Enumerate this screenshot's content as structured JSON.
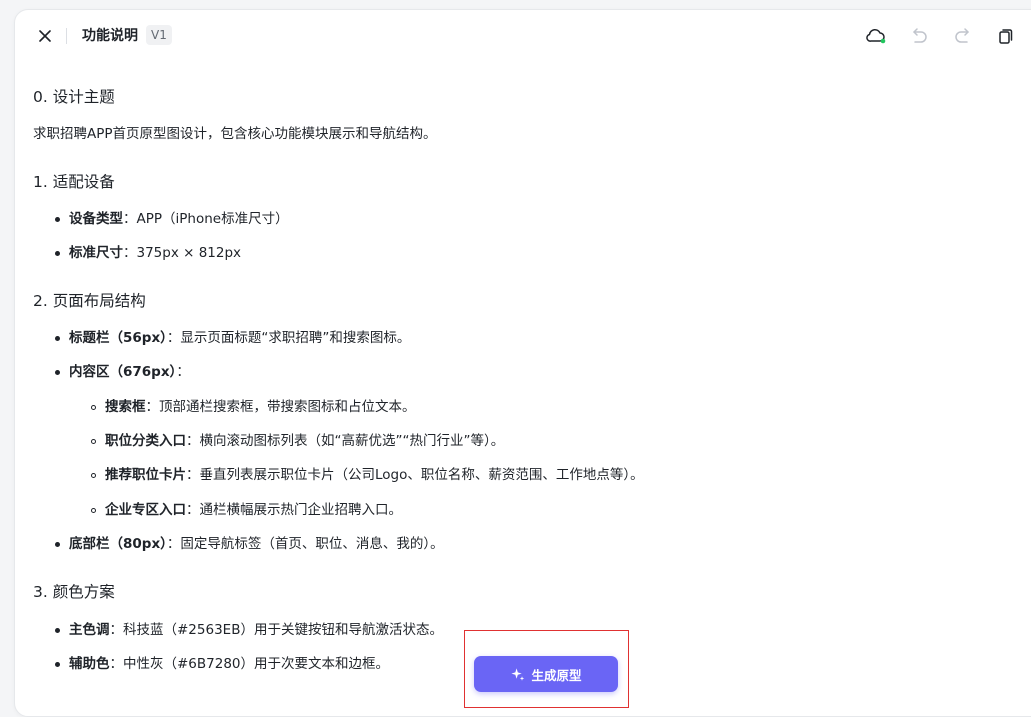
{
  "header": {
    "title": "功能说明",
    "version": "V1",
    "icons": [
      "close-icon",
      "cloud-sync-icon",
      "undo-icon",
      "redo-icon",
      "copy-icon"
    ]
  },
  "doc": {
    "s0": {
      "heading": "0. 设计主题",
      "text": "求职招聘APP首页原型图设计，包含核心功能模块展示和导航结构。"
    },
    "s1": {
      "heading": "1. 适配设备",
      "items": [
        {
          "label": "设备类型",
          "text": "：APP（iPhone标准尺寸）"
        },
        {
          "label": "标准尺寸",
          "text": "：375px × 812px"
        }
      ]
    },
    "s2": {
      "heading": "2. 页面布局结构",
      "items": [
        {
          "label": "标题栏（56px）",
          "text": "：显示页面标题“求职招聘”和搜索图标。"
        },
        {
          "label": "内容区（676px）",
          "text": "："
        },
        {
          "label": "底部栏（80px）",
          "text": "：固定导航标签（首页、职位、消息、我的）。"
        }
      ],
      "subitems": [
        {
          "label": "搜索框",
          "text": "：顶部通栏搜索框，带搜索图标和占位文本。"
        },
        {
          "label": "职位分类入口",
          "text": "：横向滚动图标列表（如“高薪优选”“热门行业”等）。"
        },
        {
          "label": "推荐职位卡片",
          "text": "：垂直列表展示职位卡片（公司Logo、职位名称、薪资范围、工作地点等）。"
        },
        {
          "label": "企业专区入口",
          "text": "：通栏横幅展示热门企业招聘入口。"
        }
      ]
    },
    "s3": {
      "heading": "3. 颜色方案",
      "items": [
        {
          "label": "主色调",
          "text": "：科技蓝（#2563EB）用于关键按钮和导航激活状态。"
        },
        {
          "label": "辅助色",
          "text": "：中性灰（#6B7280）用于次要文本和边框。"
        }
      ]
    }
  },
  "action": {
    "generate_label": "生成原型",
    "icon": "sparkle-icon"
  },
  "colors": {
    "accent": "#6a65f5",
    "highlight_box": "#e03131",
    "sync_ok": "#22c55e"
  }
}
